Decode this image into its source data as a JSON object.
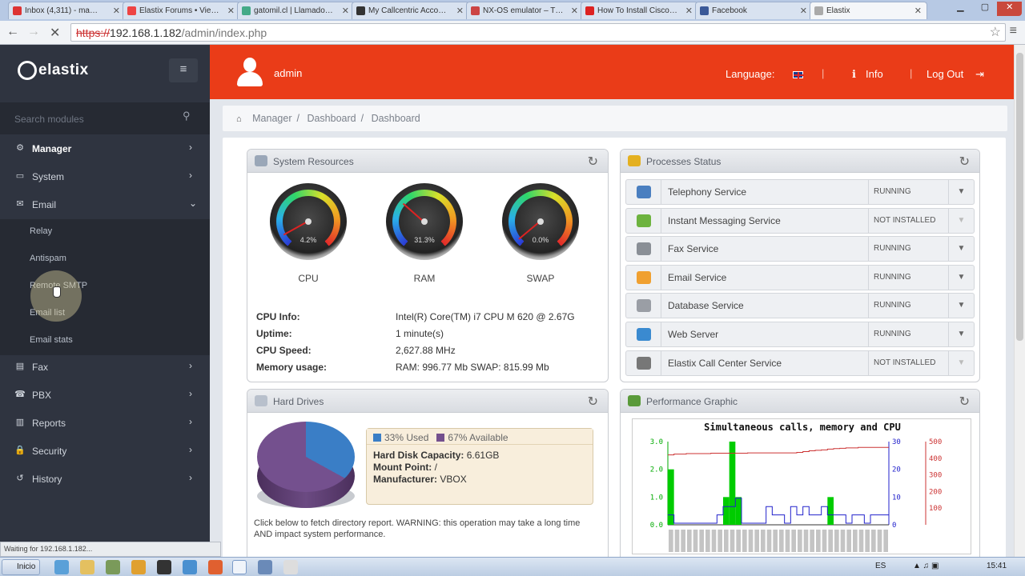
{
  "browser": {
    "tabs": [
      {
        "label": "Inbox (4,311) - ma…",
        "color": "#d33"
      },
      {
        "label": "Elastix Forums • Vie…",
        "color": "#e44"
      },
      {
        "label": "gatomil.cl | Llamado…",
        "color": "#4a8"
      },
      {
        "label": "My Callcentric Acco…",
        "color": "#333"
      },
      {
        "label": "NX-OS emulator – T…",
        "color": "#c44"
      },
      {
        "label": "How To Install Cisco…",
        "color": "#d22"
      },
      {
        "label": "Facebook",
        "color": "#3b5998"
      },
      {
        "label": "Elastix",
        "color": "#aaa"
      }
    ],
    "url_scheme": "https://",
    "url_host": "192.168.1.182",
    "url_path": "/admin/index.php",
    "status": "Waiting for 192.168.1.182..."
  },
  "sidebar": {
    "brand": "elastix",
    "search_placeholder": "Search modules",
    "items": [
      {
        "label": "Manager",
        "icon": "gear-icon",
        "glyph": "⚙",
        "arrow": "›"
      },
      {
        "label": "System",
        "icon": "monitor-icon",
        "glyph": "▭",
        "arrow": "›"
      },
      {
        "label": "Email",
        "icon": "envelope-icon",
        "glyph": "✉",
        "arrow": "⌄"
      },
      {
        "label": "Fax",
        "icon": "fax-icon",
        "glyph": "▤",
        "arrow": "›"
      },
      {
        "label": "PBX",
        "icon": "phone-icon",
        "glyph": "☎",
        "arrow": "›"
      },
      {
        "label": "Reports",
        "icon": "chart-icon",
        "glyph": "▥",
        "arrow": "›"
      },
      {
        "label": "Security",
        "icon": "lock-icon",
        "glyph": "🔒",
        "arrow": "›"
      },
      {
        "label": "History",
        "icon": "history-icon",
        "glyph": "↺",
        "arrow": "›"
      }
    ],
    "email_sub": [
      "Relay",
      "Antispam",
      "Remote SMTP",
      "Email list",
      "Email stats"
    ]
  },
  "header": {
    "username": "admin",
    "language_label": "Language:",
    "info_label": "Info",
    "logout_label": "Log Out"
  },
  "breadcrumb": [
    "Manager",
    "Dashboard",
    "Dashboard"
  ],
  "system_resources": {
    "title": "System Resources",
    "gauges": [
      {
        "label": "CPU",
        "value_text": "4.2%",
        "value": 4.2
      },
      {
        "label": "RAM",
        "value_text": "31.3%",
        "value": 31.3
      },
      {
        "label": "SWAP",
        "value_text": "0.0%",
        "value": 0.0
      }
    ],
    "info": [
      {
        "key": "CPU Info:",
        "value": "Intel(R) Core(TM) i7 CPU M 620 @ 2.67G"
      },
      {
        "key": "Uptime:",
        "value": "1 minute(s)"
      },
      {
        "key": "CPU Speed:",
        "value": "2,627.88 MHz"
      },
      {
        "key": "Memory usage:",
        "value": "RAM: 996.77 Mb SWAP: 815.99 Mb"
      }
    ]
  },
  "processes": {
    "title": "Processes Status",
    "rows": [
      {
        "name": "Telephony Service",
        "status": "RUNNING",
        "icon": "phone-icon",
        "color": "#4a7fc0"
      },
      {
        "name": "Instant Messaging Service",
        "status": "NOT INSTALLED",
        "icon": "chat-icon",
        "color": "#6db33f"
      },
      {
        "name": "Fax Service",
        "status": "RUNNING",
        "icon": "fax-icon",
        "color": "#8a8f96"
      },
      {
        "name": "Email Service",
        "status": "RUNNING",
        "icon": "envelope-icon",
        "color": "#f0a030"
      },
      {
        "name": "Database Service",
        "status": "RUNNING",
        "icon": "database-icon",
        "color": "#9a9ea5"
      },
      {
        "name": "Web Server",
        "status": "RUNNING",
        "icon": "globe-icon",
        "color": "#3a8ad0"
      },
      {
        "name": "Elastix Call Center Service",
        "status": "NOT INSTALLED",
        "icon": "headset-icon",
        "color": "#777"
      }
    ]
  },
  "hard_drives": {
    "title": "Hard Drives",
    "used_label": "33% Used",
    "available_label": "67% Available",
    "used_fraction": 0.33,
    "used_color": "#3a7ec6",
    "available_color": "#74508e",
    "details": [
      {
        "key": "Hard Disk Capacity:",
        "value": "6.61GB"
      },
      {
        "key": "Mount Point:",
        "value": "/"
      },
      {
        "key": "Manufacturer:",
        "value": "VBOX"
      }
    ],
    "note": "Click below to fetch directory report. WARNING: this operation may take a long time AND impact system performance."
  },
  "performance": {
    "title": "Performance Graphic"
  },
  "chart_data": {
    "type": "bar",
    "title": "Simultaneous calls, memory and CPU",
    "y_left_ticks": [
      "0.0",
      "1.0",
      "2.0",
      "3.0"
    ],
    "y_mid_ticks": [
      "0",
      "10",
      "20",
      "30"
    ],
    "y_right_ticks": [
      "100",
      "200",
      "300",
      "400",
      "500"
    ],
    "ylim_left": [
      0,
      3
    ],
    "ylim_mid": [
      0,
      30
    ],
    "ylim_right": [
      0,
      500
    ],
    "series": [
      {
        "color": "#00cc00",
        "values": [
          2,
          0,
          0,
          0,
          0,
          0,
          0,
          0,
          0,
          1,
          3,
          1,
          0,
          0,
          0,
          0,
          0,
          0,
          0,
          0,
          0,
          0,
          0,
          0,
          0,
          0,
          1,
          0,
          0,
          0,
          0,
          0,
          0,
          0,
          0,
          0
        ]
      },
      {
        "color": "#2222cc",
        "values": [
          1,
          0,
          0,
          0,
          0,
          0,
          0,
          0,
          1,
          2,
          2,
          3,
          0,
          0,
          0,
          0,
          2,
          1,
          1,
          0,
          2,
          1,
          2,
          1,
          1,
          2,
          1,
          1,
          1,
          0,
          1,
          1,
          0,
          1,
          1,
          1
        ]
      },
      {
        "color": "#cc3333",
        "values": [
          420,
          425,
          425,
          428,
          428,
          428,
          428,
          430,
          430,
          430,
          430,
          430,
          430,
          432,
          432,
          432,
          432,
          432,
          432,
          432,
          432,
          435,
          440,
          445,
          448,
          450,
          455,
          458,
          460,
          462,
          462,
          465,
          465,
          465,
          465,
          465
        ]
      }
    ]
  },
  "taskbar": {
    "start_label": "Inicio",
    "lang": "ES",
    "time": "15:41"
  }
}
